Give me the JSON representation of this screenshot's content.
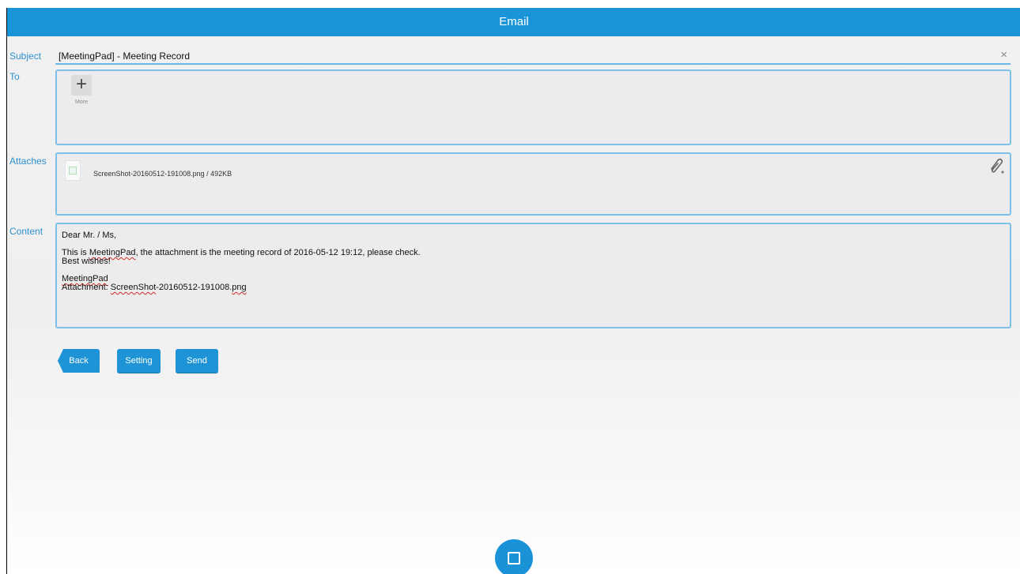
{
  "window": {
    "title": "Email"
  },
  "subject": {
    "label": "Subject",
    "value": "[MeetingPad] - Meeting Record",
    "clear_icon": "×"
  },
  "to": {
    "label": "To",
    "add_icon": "+",
    "add_caption": "More"
  },
  "attaches": {
    "label": "Attaches",
    "file_name": "ScreenShot-20160512-191008.png / 492KB",
    "attach_icon": "paperclip-plus-icon"
  },
  "content": {
    "label": "Content",
    "greeting": "Dear Mr. / Ms,",
    "body_pre": "This is ",
    "body_app": "MeetingPad",
    "body_post": ", the attachment is the meeting record of 2016-05-12 19:12, please check.",
    "closing": "Best wishes!",
    "signature": "MeetingPad",
    "attachment_prefix": "Attachment: ",
    "attachment_file": "ScreenShot",
    "attachment_mid": "-20160512-191008.",
    "attachment_ext": "png"
  },
  "buttons": {
    "back": "Back",
    "setting": "Setting",
    "send": "Send"
  },
  "nav": {
    "home_icon": "square-icon"
  },
  "colors": {
    "accent": "#1a94d8",
    "border": "#7cc0ea",
    "label": "#2f90d2"
  }
}
